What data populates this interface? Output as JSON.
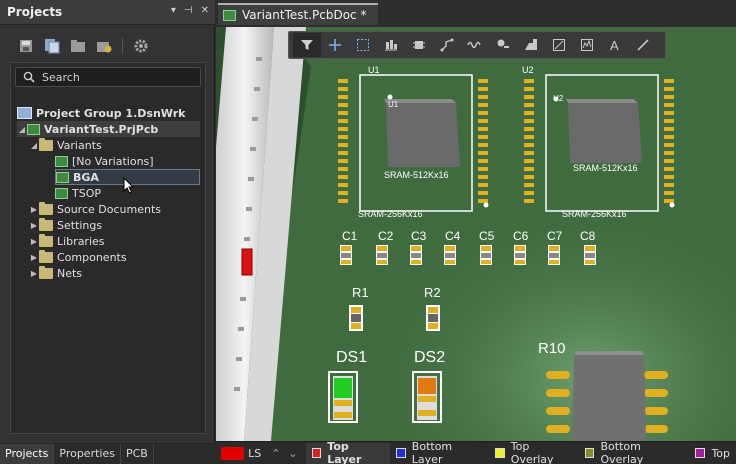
{
  "projects_panel": {
    "title": "Projects",
    "title_buttons": [
      "▾",
      "⊣",
      "✕"
    ],
    "search_placeholder": "Search",
    "tree": [
      {
        "label": "Project Group 1.DsnWrk"
      },
      {
        "label": "VariantTest.PrjPcb"
      },
      {
        "label": "Variants"
      },
      {
        "label": "[No Variations]"
      },
      {
        "label": "BGA"
      },
      {
        "label": "TSOP"
      },
      {
        "label": "Source Documents"
      },
      {
        "label": "Settings"
      },
      {
        "label": "Libraries"
      },
      {
        "label": "Components"
      },
      {
        "label": "Nets"
      }
    ],
    "bottom_tabs": [
      "Projects",
      "Properties",
      "PCB"
    ]
  },
  "document": {
    "tab_label": "VariantTest.PcbDoc *"
  },
  "pcb": {
    "designators": [
      "U1",
      "U2",
      "C1",
      "C2",
      "C3",
      "C4",
      "C5",
      "C6",
      "C7",
      "C8",
      "R1",
      "R2",
      "DS1",
      "DS2",
      "R10"
    ],
    "chip_label_1": "SRAM-512Kx16",
    "chip_label_2": "SRAM-512Kx16",
    "outline_label_1": "SRAM-256Kx16",
    "outline_label_2": "SRAM-256Kx16",
    "u1_small": "U1",
    "u2_small": "U2",
    "board_color": "#3f6b3f"
  },
  "layer_bar": {
    "current_swatch_label": "LS",
    "layers": [
      {
        "name": "Top Layer",
        "color": "#e02020"
      },
      {
        "name": "Bottom Layer",
        "color": "#2030e0"
      },
      {
        "name": "Top Overlay",
        "color": "#f0f020"
      },
      {
        "name": "Bottom Overlay",
        "color": "#8a8a20"
      },
      {
        "name": "Top",
        "color": "#a020a0"
      }
    ]
  }
}
